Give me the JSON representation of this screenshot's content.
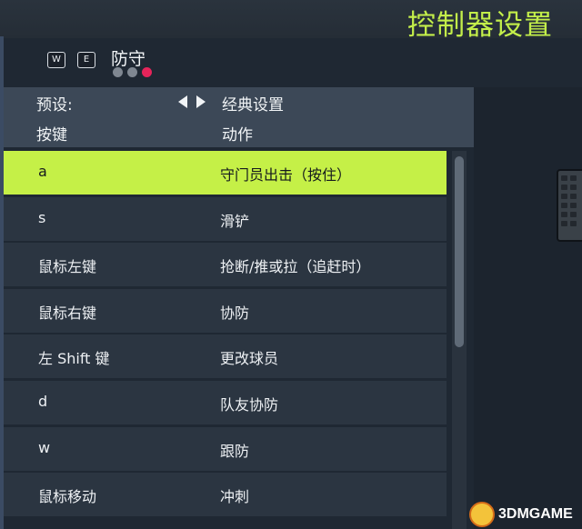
{
  "page": {
    "title": "控制器设置"
  },
  "tab": {
    "key_left": "W",
    "key_right": "E",
    "title": "防守",
    "dots": [
      "#7f8791",
      "#7f8791",
      "#e6245a"
    ]
  },
  "header": {
    "preset_label": "预设:",
    "preset_value": "经典设置",
    "col_key": "按键",
    "col_action": "动作"
  },
  "rows": [
    {
      "key": "a",
      "action": "守门员出击（按住）"
    },
    {
      "key": "s",
      "action": "滑铲"
    },
    {
      "key": "鼠标左键",
      "action": "抢断/推或拉（追赶时）"
    },
    {
      "key": "鼠标右键",
      "action": "协防"
    },
    {
      "key": "左 Shift 键",
      "action": "更改球员"
    },
    {
      "key": "d",
      "action": "队友协防"
    },
    {
      "key": "w",
      "action": "跟防"
    },
    {
      "key": "鼠标移动",
      "action": "冲刺"
    }
  ],
  "watermark": {
    "text": "3DMGAME"
  },
  "colors": {
    "accent": "#c5f047",
    "title": "#c3ee4a"
  }
}
